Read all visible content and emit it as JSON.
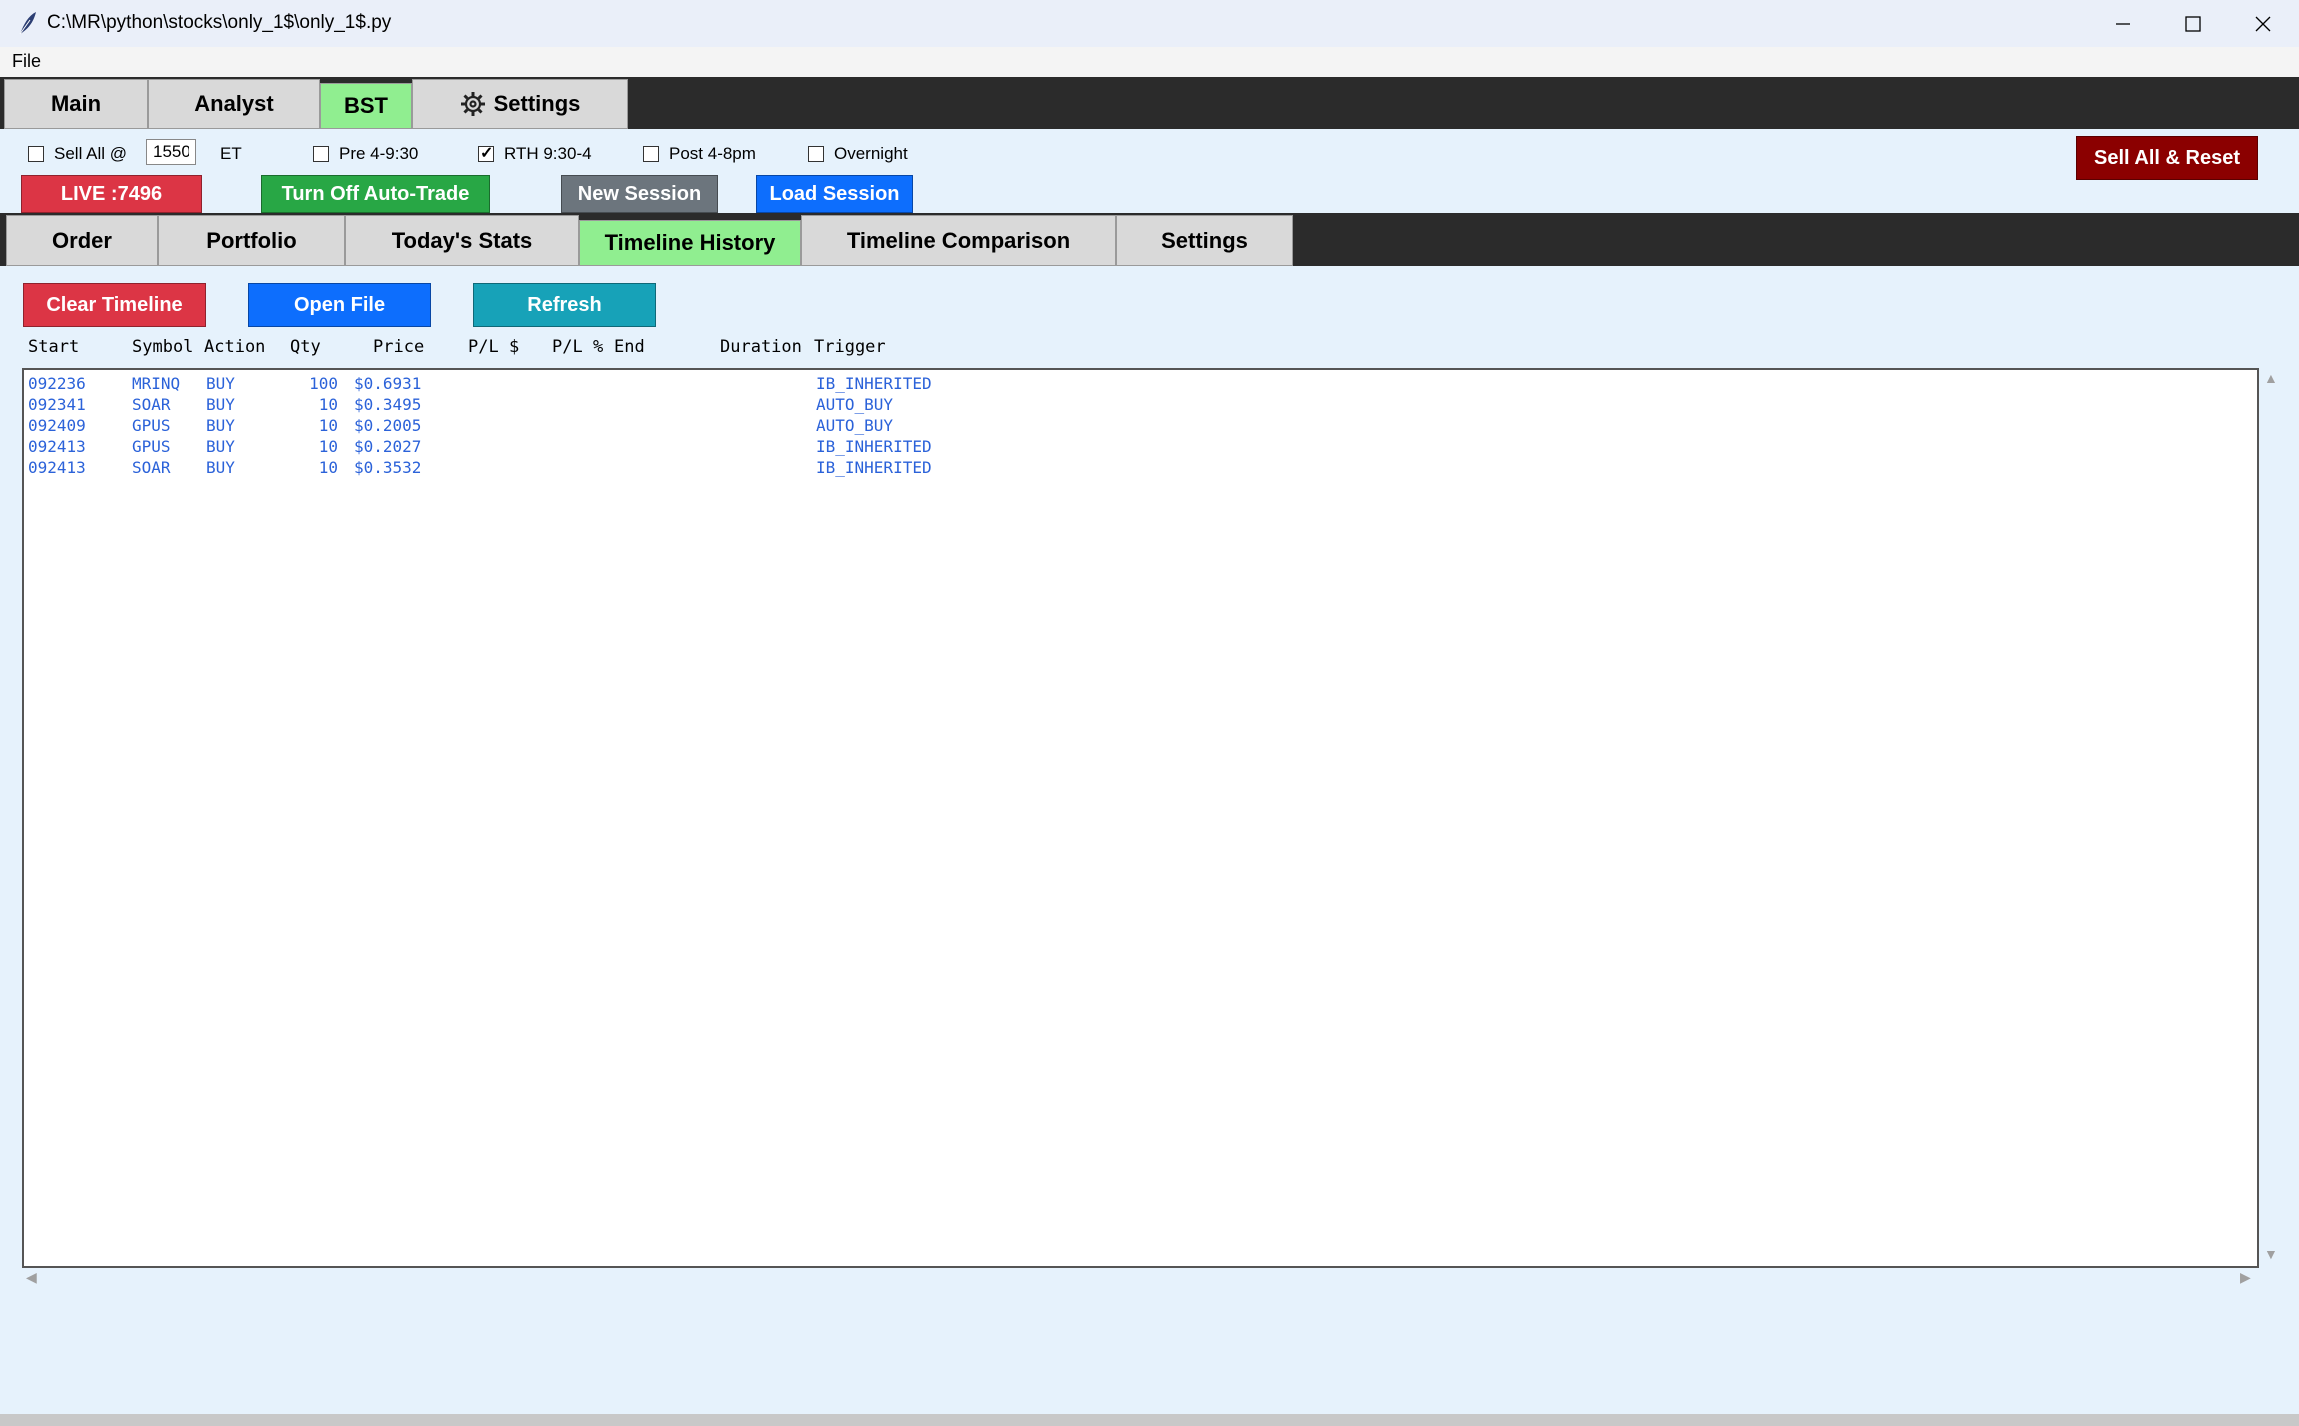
{
  "window": {
    "title": "C:\\MR\\python\\stocks\\only_1$\\only_1$.py"
  },
  "menu": {
    "file_label": "File"
  },
  "main_tabs": [
    {
      "label": "Main",
      "active": false
    },
    {
      "label": "Analyst",
      "active": false
    },
    {
      "label": "BST",
      "active": true
    },
    {
      "label": "Settings",
      "active": false,
      "icon": "gear-icon"
    }
  ],
  "controls": {
    "sell_all_label": "Sell All @",
    "sell_all_checked": false,
    "sell_all_time": "1550",
    "et_label": "ET",
    "pre_label": "Pre 4-9:30",
    "pre_checked": false,
    "rth_label": "RTH 9:30-4",
    "rth_checked": true,
    "post_label": "Post 4-8pm",
    "post_checked": false,
    "overnight_label": "Overnight",
    "overnight_checked": false,
    "sell_reset_label": "Sell All & Reset",
    "live_label": "LIVE :7496",
    "auto_trade_label": "Turn Off Auto-Trade",
    "new_session_label": "New Session",
    "load_session_label": "Load Session"
  },
  "sub_tabs": [
    {
      "label": "Order",
      "active": false
    },
    {
      "label": "Portfolio",
      "active": false
    },
    {
      "label": "Today's Stats",
      "active": false
    },
    {
      "label": "Timeline History",
      "active": true
    },
    {
      "label": "Timeline Comparison",
      "active": false
    },
    {
      "label": "Settings",
      "active": false
    }
  ],
  "timeline": {
    "clear_label": "Clear Timeline",
    "open_label": "Open File",
    "refresh_label": "Refresh",
    "columns": {
      "start": "Start",
      "symbol": "Symbol",
      "action": "Action",
      "qty": "Qty",
      "price": "Price",
      "pl_dollar": "P/L $",
      "pl_pct": "P/L %",
      "end": "End",
      "duration": "Duration",
      "trigger": "Trigger"
    },
    "rows": [
      {
        "start": "092236",
        "symbol": "MRINQ",
        "action": "BUY",
        "qty": "100",
        "price": "$0.6931",
        "trigger": "IB_INHERITED"
      },
      {
        "start": "092341",
        "symbol": "SOAR",
        "action": "BUY",
        "qty": "10",
        "price": "$0.3495",
        "trigger": "AUTO_BUY"
      },
      {
        "start": "092409",
        "symbol": "GPUS",
        "action": "BUY",
        "qty": "10",
        "price": "$0.2005",
        "trigger": "AUTO_BUY"
      },
      {
        "start": "092413",
        "symbol": "GPUS",
        "action": "BUY",
        "qty": "10",
        "price": "$0.2027",
        "trigger": "IB_INHERITED"
      },
      {
        "start": "092413",
        "symbol": "SOAR",
        "action": "BUY",
        "qty": "10",
        "price": "$0.3532",
        "trigger": "IB_INHERITED"
      }
    ]
  },
  "colors": {
    "background": "#e6f2fc",
    "active_tab": "#90ee90",
    "live_red": "#dc3545",
    "auto_green": "#28a745",
    "new_session_gray": "#6c757d",
    "load_blue": "#0d6efd",
    "sell_reset_red": "#8b0000",
    "refresh_teal": "#17a2b8",
    "row_text": "#2b62d9"
  }
}
